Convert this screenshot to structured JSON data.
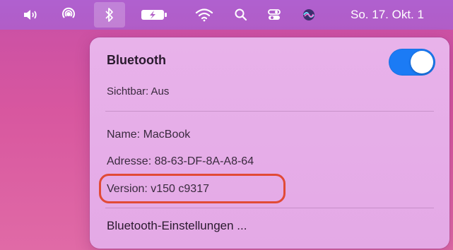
{
  "menubar": {
    "clock": "So. 17. Okt. 1",
    "icons": [
      "volume-icon",
      "airplay-icon",
      "bluetooth-icon",
      "battery-charging-icon",
      "wifi-icon",
      "spotlight-search-icon",
      "control-center-icon",
      "siri-icon"
    ]
  },
  "bluetooth_menu": {
    "title": "Bluetooth",
    "toggle_on": true,
    "accent_color": "#1b7bf5",
    "visible_status": "Sichtbar: Aus",
    "name": "Name: MacBook",
    "address": "Adresse: 88-63-DF-8A-A8-64",
    "version": "Version: v150 c9317",
    "settings_label": "Bluetooth-Einstellungen ..."
  },
  "highlight_color": "#e14a36"
}
